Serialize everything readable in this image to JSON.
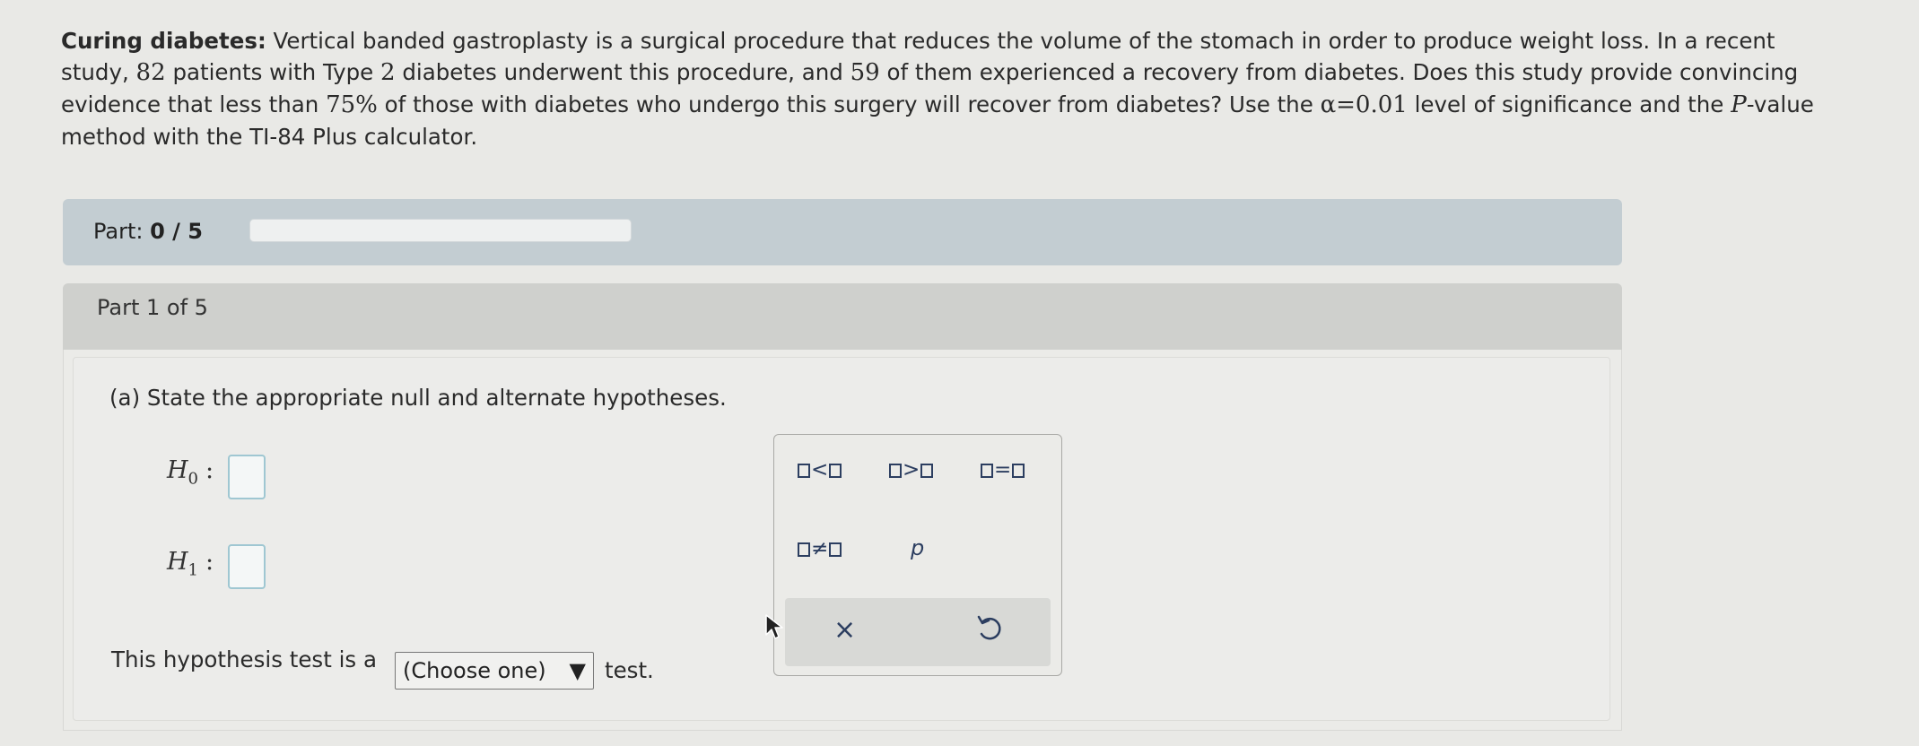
{
  "problem": {
    "title": "Curing diabetes:",
    "text_1": "Vertical banded gastroplasty is a surgical procedure that reduces the volume of the stomach in order to produce weight loss. In a recent",
    "text_2a": "study,",
    "n": "82",
    "text_2b": "patients with Type",
    "type_num": "2",
    "text_2c": "diabetes underwent this procedure, and",
    "x": "59",
    "text_2d": "of them experienced a recovery from diabetes. Does this study provide convincing",
    "text_3a": "evidence that less than",
    "pct": "75%",
    "text_3b": "of those with diabetes who undergo this surgery will recover from diabetes? Use the",
    "alpha": "α=0.01",
    "text_3c": "level of significance and the",
    "p_letter": "P",
    "text_3d": "-value",
    "text_4": "method with the TI-84 Plus calculator."
  },
  "progress": {
    "label_prefix": "Part:",
    "value_text": "0 / 5",
    "fraction": 0
  },
  "part": {
    "header": "Part 1 of 5",
    "question": "(a) State the appropriate null and alternate hypotheses.",
    "h0_letter": "H",
    "h0_sub": "0",
    "h1_letter": "H",
    "h1_sub": "1",
    "colon": ":",
    "test_prefix": "This hypothesis test is a",
    "test_select_value": "(Choose one)",
    "test_select_arrow": "▼",
    "test_suffix": "test."
  },
  "palette": {
    "lt": "<",
    "gt": ">",
    "eq": "=",
    "neq": "≠",
    "p": "p",
    "clear": "×"
  }
}
